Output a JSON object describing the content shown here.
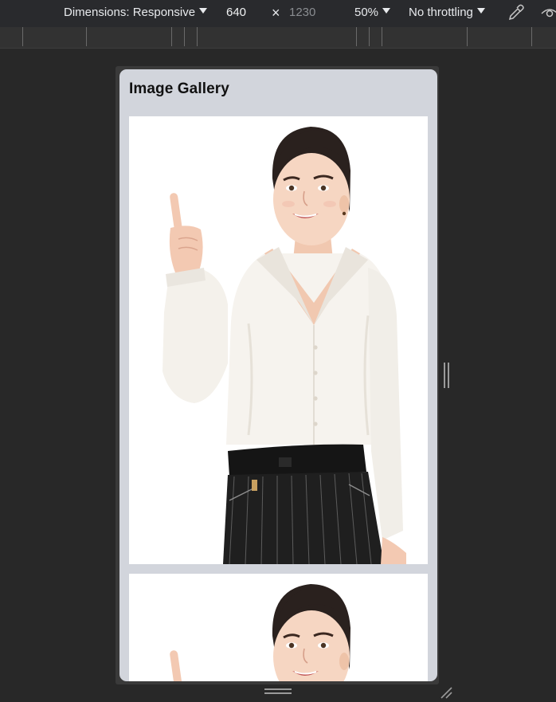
{
  "toolbar": {
    "dimensions_label": "Dimensions: Responsive",
    "width_value": "640",
    "times_symbol": "×",
    "height_value": "1230",
    "zoom_label": "50%",
    "throttling_label": "No throttling",
    "eyedropper_icon": "eyedropper-icon",
    "sensors_icon": "eye-icon"
  },
  "page": {
    "title": "Image Gallery",
    "images": [
      {
        "subject": "woman in white shirt pointing up"
      },
      {
        "subject": "woman in white shirt pointing up"
      }
    ]
  },
  "colors": {
    "devtools_bg": "#282828",
    "toolbar_bg": "#292a2d",
    "page_bg": "#d2d5dc",
    "card_bg": "#ffffff"
  }
}
